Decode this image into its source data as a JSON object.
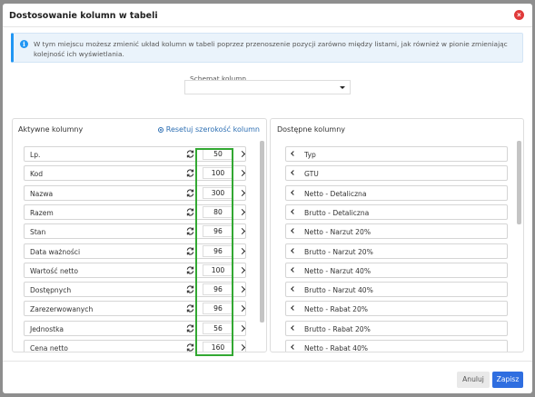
{
  "modal": {
    "title": "Dostosowanie kolumn w tabeli",
    "info_text": "W tym miejscu możesz zmienić układ kolumn w tabeli poprzez przenoszenie pozycji zarówno między listami, jak również w pionie zmieniając kolejność ich wyświetlania.",
    "schema": {
      "label": "Schemat kolumn",
      "selected": ""
    }
  },
  "active": {
    "title": "Aktywne kolumny",
    "reset_label": "Resetuj szerokość kolumn",
    "items": [
      {
        "label": "Lp.",
        "width": "50"
      },
      {
        "label": "Kod",
        "width": "100"
      },
      {
        "label": "Nazwa",
        "width": "300"
      },
      {
        "label": "Razem",
        "width": "80"
      },
      {
        "label": "Stan",
        "width": "96"
      },
      {
        "label": "Data ważności",
        "width": "96"
      },
      {
        "label": "Wartość netto",
        "width": "100"
      },
      {
        "label": "Dostępnych",
        "width": "96"
      },
      {
        "label": "Zarezerwowanych",
        "width": "96"
      },
      {
        "label": "Jednostka",
        "width": "56"
      },
      {
        "label": "Cena netto",
        "width": "160"
      }
    ]
  },
  "available": {
    "title": "Dostępne kolumny",
    "items": [
      {
        "label": "Typ"
      },
      {
        "label": "GTU"
      },
      {
        "label": "Netto - Detaliczna"
      },
      {
        "label": "Brutto - Detaliczna"
      },
      {
        "label": "Netto - Narzut 20%"
      },
      {
        "label": "Brutto - Narzut 20%"
      },
      {
        "label": "Netto - Narzut 40%"
      },
      {
        "label": "Brutto - Narzut 40%"
      },
      {
        "label": "Netto - Rabat 20%"
      },
      {
        "label": "Brutto - Rabat 20%"
      },
      {
        "label": "Netto - Rabat 40%"
      }
    ]
  },
  "footer": {
    "cancel_label": "Anuluj",
    "save_label": "Zapisz"
  },
  "colors": {
    "accent": "#2f6ee0",
    "close": "#e03a3a",
    "highlight": "#32a832",
    "info": "#2196f3"
  }
}
